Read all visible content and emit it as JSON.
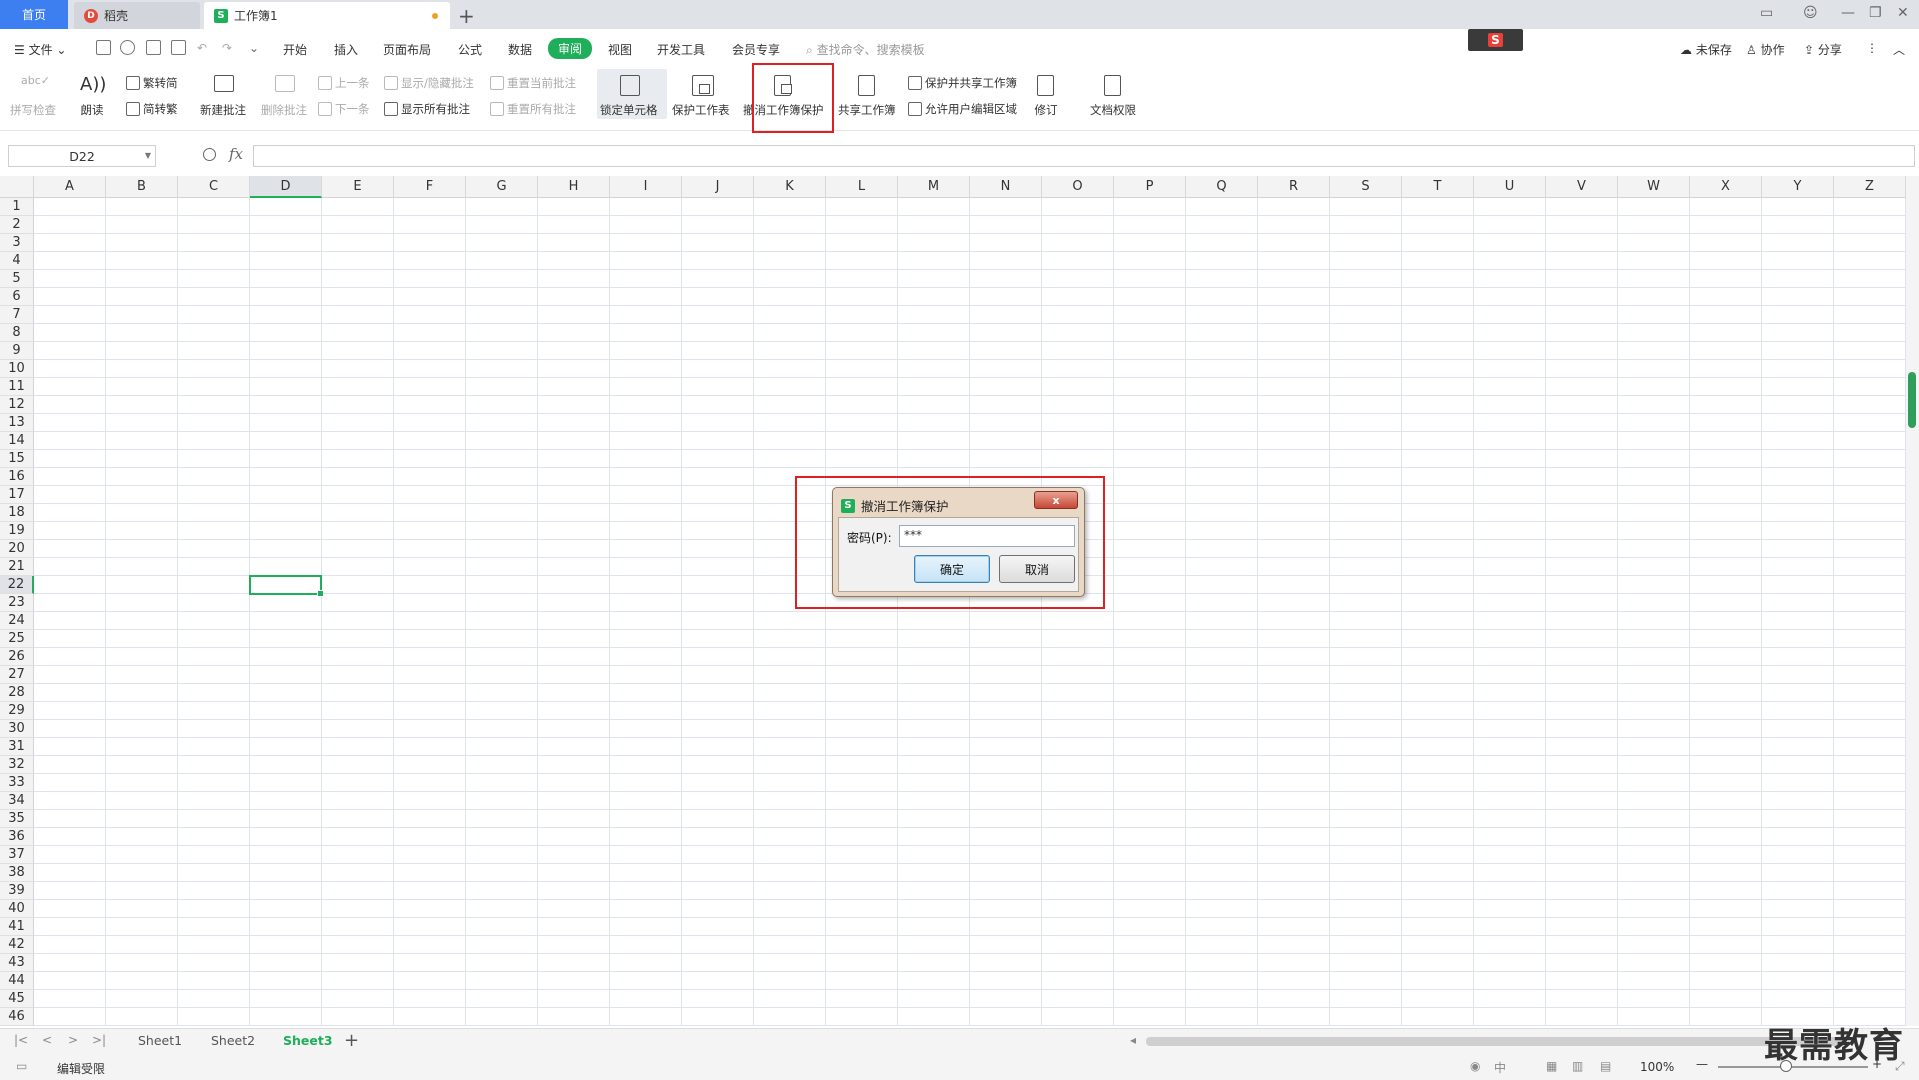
{
  "tabs": {
    "home": "首页",
    "daoke": "稻壳",
    "workbook": "工作簿1"
  },
  "menu": {
    "file": "文件",
    "items": [
      "开始",
      "插入",
      "页面布局",
      "公式",
      "数据",
      "审阅",
      "视图",
      "开发工具",
      "会员专享"
    ],
    "active_index": 5,
    "search_placeholder": "查找命令、搜索模板",
    "unsaved": "未保存",
    "collab": "协作",
    "share": "分享"
  },
  "ribbon": {
    "spell_check": "拼写检查",
    "read_aloud": "朗读",
    "trad_to_simp": "繁转简",
    "simp_to_trad": "简转繁",
    "new_comment": "新建批注",
    "delete_comment": "删除批注",
    "prev_comment": "上一条",
    "next_comment": "下一条",
    "toggle_comment": "显示/隐藏批注",
    "show_all_comments": "显示所有批注",
    "reset_current_comment": "重置当前批注",
    "reset_all_comments": "重置所有批注",
    "lock_cells": "锁定单元格",
    "protect_sheet": "保护工作表",
    "unprotect_workbook": "撤消工作簿保护",
    "share_workbook": "共享工作簿",
    "protect_share_workbook": "保护并共享工作簿",
    "allow_edit_ranges": "允许用户编辑区域",
    "revise": "修订",
    "doc_permission": "文档权限"
  },
  "formula_bar": {
    "name_box": "D22",
    "fx": "fx",
    "formula": ""
  },
  "grid": {
    "columns": [
      "A",
      "B",
      "C",
      "D",
      "E",
      "F",
      "G",
      "H",
      "I",
      "J",
      "K",
      "L",
      "M",
      "N",
      "O",
      "P",
      "Q",
      "R",
      "S",
      "T",
      "U",
      "V",
      "W",
      "X",
      "Y",
      "Z"
    ],
    "rows": [
      "1",
      "2",
      "3",
      "4",
      "5",
      "6",
      "7",
      "8",
      "9",
      "10",
      "11",
      "12",
      "13",
      "14",
      "15",
      "16",
      "17",
      "18",
      "19",
      "20",
      "21",
      "22",
      "23",
      "24",
      "25",
      "26",
      "27",
      "28",
      "29",
      "30",
      "31",
      "32",
      "33",
      "34",
      "35",
      "36",
      "37",
      "38",
      "39",
      "40",
      "41",
      "42",
      "43",
      "44",
      "45",
      "46"
    ],
    "selected_column": "D",
    "selected_row": "22"
  },
  "sheets": {
    "tabs": [
      "Sheet1",
      "Sheet2",
      "Sheet3"
    ],
    "active": "Sheet3"
  },
  "status": {
    "mode": "编辑受限",
    "zoom": "100%"
  },
  "dialog": {
    "title": "撤消工作簿保护",
    "password_label": "密码(P):",
    "password_value": "***",
    "ok": "确定",
    "cancel": "取消",
    "close": "x"
  },
  "watermark": "最需教育",
  "colors": {
    "accent_green": "#1fae5a",
    "tab_blue": "#3d7ff0",
    "highlight_red": "#e02020"
  }
}
